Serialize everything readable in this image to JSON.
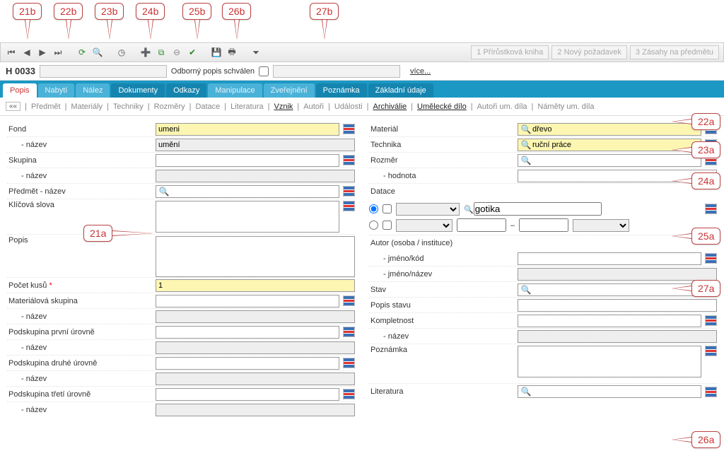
{
  "callouts": {
    "top": [
      "21b",
      "22b",
      "23b",
      "24b",
      "25b",
      "26b",
      "27b"
    ],
    "r22a": "22a",
    "r23a": "23a",
    "r24a": "24a",
    "r25a": "25a",
    "r26a": "26a",
    "r27a": "27a",
    "l21a": "21a"
  },
  "header": {
    "code": "H 0033",
    "approval_label": "Odborný popis schválen",
    "more": "více..."
  },
  "top_buttons": {
    "b1": "1 Přírůstková kniha",
    "b2": "2 Nový požadavek",
    "b3": "3 Zásahy na předmětu"
  },
  "tabs": {
    "popis": "Popis",
    "nabyti": "Nabytí",
    "nalez": "Nález",
    "dokumenty": "Dokumenty",
    "odkazy": "Odkazy",
    "manipulace": "Manipulace",
    "zverejneni": "Zveřejnění",
    "poznamka": "Poznámka",
    "zakladni": "Základní údaje"
  },
  "subnav": {
    "back": "««",
    "predmet": "Předmět",
    "materialy": "Materiály",
    "techniky": "Techniky",
    "rozmery": "Rozměry",
    "datace": "Datace",
    "literatura": "Literatura",
    "vznik": "Vznik",
    "autori": "Autoři",
    "udalosti": "Události",
    "archivalie": "Archiválie",
    "umdilo": "Umělecké dílo",
    "autori_um": "Autoři um. díla",
    "namety": "Náměty um. díla"
  },
  "left": {
    "fond": "Fond",
    "fond_val": "umeni",
    "nazev": "- název",
    "fond_nazev_val": "umění",
    "skupina": "Skupina",
    "predmet_nazev": "Předmět - název",
    "klicova": "Klíčová slova",
    "popis": "Popis",
    "pocet_kusu": "Počet kusů",
    "pocet_kusu_req": "*",
    "pocet_kusu_val": "1",
    "mat_skup": "Materiálová skupina",
    "pod1": "Podskupina první úrovně",
    "pod2": "Podskupina druhé úrovně",
    "pod3": "Podskupina třetí úrovně"
  },
  "right": {
    "material": "Materiál",
    "material_val": "dřevo",
    "technika": "Technika",
    "technika_val": "ruční práce",
    "rozmer": "Rozměr",
    "hodnota": "- hodnota",
    "datace": "Datace",
    "datace_val": "gotika",
    "autor": "Autor (osoba / instituce)",
    "jmeno_kod": "- jméno/kód",
    "jmeno_nazev": "- jméno/název",
    "stav": "Stav",
    "popis_stavu": "Popis stavu",
    "kompletnost": "Kompletnost",
    "poznamka": "Poznámka",
    "literatura": "Literatura",
    "dash": "–"
  }
}
